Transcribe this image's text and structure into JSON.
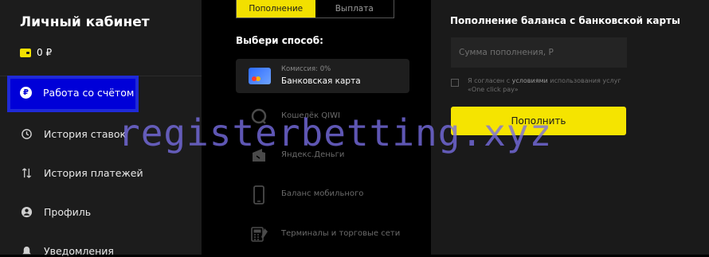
{
  "sidebar": {
    "title": "Личный кабинет",
    "balance": "0 ₽",
    "items": [
      {
        "label": "Работа со счётом",
        "icon": "ruble-circle-icon"
      },
      {
        "label": "История ставок",
        "icon": "history-icon"
      },
      {
        "label": "История платежей",
        "icon": "transfer-arrows-icon"
      },
      {
        "label": "Профиль",
        "icon": "user-icon"
      },
      {
        "label": "Уведомления",
        "icon": "bell-icon"
      }
    ]
  },
  "tabs": {
    "deposit": "Пополнение",
    "withdraw": "Выплата"
  },
  "methods": {
    "heading": "Выбери способ:",
    "card_commission": "Комиссия: 0%",
    "card_name": "Банковская карта",
    "items": [
      {
        "label": "Кошелёк QIWI",
        "icon": "qiwi-icon"
      },
      {
        "label": "Яндекс.Деньги",
        "icon": "yandex-money-icon"
      },
      {
        "label": "Баланс мобильного",
        "icon": "phone-icon"
      },
      {
        "label": "Терминалы и торговые сети",
        "icon": "terminal-icon"
      }
    ]
  },
  "panel": {
    "title": "Пополнение баланса с банковской карты",
    "amount_placeholder": "Сумма пополнения, Р",
    "agree_prefix": "Я согласен с ",
    "agree_link": "условиями",
    "agree_suffix": " использования услуг «One click pay»",
    "submit": "Пополнить"
  },
  "watermark": "registerbetting.xyz",
  "colors": {
    "accent": "#f2e000",
    "active_nav": "#0000d8"
  }
}
